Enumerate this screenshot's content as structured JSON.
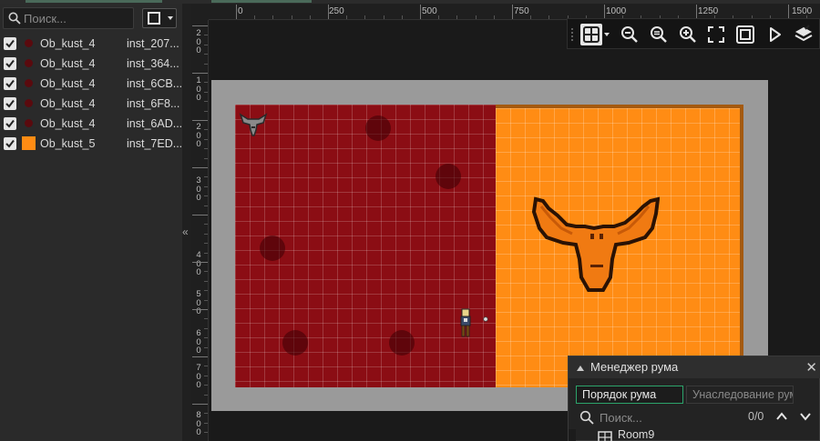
{
  "left_panel": {
    "search_placeholder": "Поиск...",
    "instances": [
      {
        "checked": true,
        "object": "Ob_kust_4",
        "instance": "inst_207...",
        "icon": "dark-red-dot-icon",
        "color": "#5a0a0e"
      },
      {
        "checked": true,
        "object": "Ob_kust_4",
        "instance": "inst_364...",
        "icon": "dark-red-dot-icon",
        "color": "#5a0a0e"
      },
      {
        "checked": true,
        "object": "Ob_kust_4",
        "instance": "inst_6CB...",
        "icon": "dark-red-dot-icon",
        "color": "#5a0a0e"
      },
      {
        "checked": true,
        "object": "Ob_kust_4",
        "instance": "inst_6F8...",
        "icon": "dark-red-dot-icon",
        "color": "#5a0a0e"
      },
      {
        "checked": true,
        "object": "Ob_kust_4",
        "instance": "inst_6AD...",
        "icon": "dark-red-dot-icon",
        "color": "#5a0a0e"
      },
      {
        "checked": true,
        "object": "Ob_kust_5",
        "instance": "inst_7ED...",
        "icon": "orange-square-icon",
        "color": "#ff8c14"
      }
    ],
    "collapse_arrow": "«"
  },
  "ruler_top": {
    "labels": [
      "0",
      "250",
      "500",
      "750",
      "1000",
      "1250",
      "1500"
    ]
  },
  "ruler_left": {
    "labels": [
      "200",
      "100",
      "200",
      "300",
      "400",
      "500",
      "600",
      "700",
      "800"
    ]
  },
  "toolbar": {
    "buttons": [
      "grid-icon",
      "zoom-out-icon",
      "zoom-reset-icon",
      "zoom-in-icon",
      "fullscreen-icon",
      "fit-icon",
      "play-icon",
      "layers-icon"
    ]
  },
  "room_manager": {
    "title": "Менеджер рума",
    "tab_active": "Порядок рума",
    "tab_inactive": "Унаследование рум",
    "search_placeholder": "Поиск...",
    "count": "0/0",
    "item": "Room9"
  },
  "colors": {
    "room_red": "#8b0d14",
    "room_orange": "#ff8c14",
    "accent_green": "#2ca46b"
  }
}
